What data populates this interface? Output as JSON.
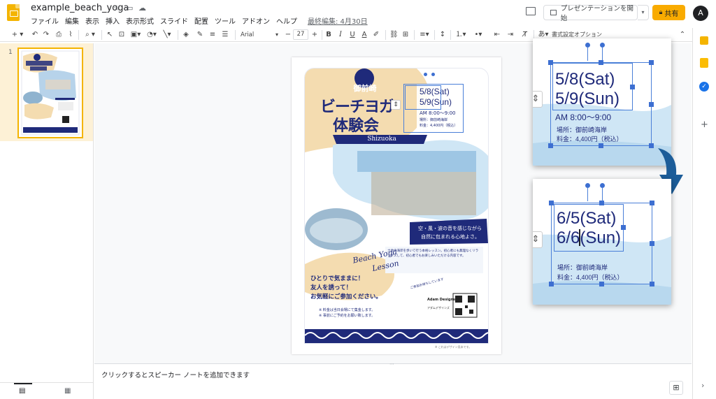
{
  "app": {
    "doc_title": "example_beach_yoga",
    "menu": [
      "ファイル",
      "編集",
      "表示",
      "挿入",
      "表示形式",
      "スライド",
      "配置",
      "ツール",
      "アドオン",
      "ヘルプ"
    ],
    "last_edit": "最終編集: 4月30日",
    "present_label": "プレゼンテーションを開始",
    "share_label": "共有",
    "avatar_letter": "A"
  },
  "toolbar": {
    "font_name": "Arial",
    "font_size": "27",
    "format_options": "書式設定オプション"
  },
  "filmstrip": {
    "slide_number": "1"
  },
  "notes": {
    "placeholder": "クリックするとスピーカー ノートを追加できます"
  },
  "poster": {
    "badge": "御前崎",
    "title_line1": "ビーチヨガ",
    "title_line2": "体験会",
    "ribbon": "Shizuoka",
    "date_line1": "5/8(Sat)",
    "date_line2": "5/9(Sun)",
    "time": "AM 8:00〜9:00",
    "place": "場所：御前崎海岸",
    "fee": "料金：4,400円（税込）",
    "banner_line1": "空・風・波の音を感じながら",
    "banner_line2": "自然に包まれる心地よさ。",
    "description": "土地の海岸を歩いて行う本格レッスン。初心者にも無理なくリラックスして、初心者でもお楽しみいただける内容です。",
    "script_line1": "Beach Yoga",
    "script_line2": "Lesson",
    "invite_line1": "ひとりで気ままに！",
    "invite_line2": "友人を誘って！",
    "invite_line3": "お気軽にご参加ください。",
    "note1": "※ 料金は当日会場にて集金します。",
    "note2": "※ 事前にご予約をお願い致します。",
    "callout_text": "ご参加お待ちしています",
    "brand": "Adam Designs",
    "brand_sub": "アダムデザインズ",
    "footer": "※ これはデザイン見本です。"
  },
  "zoom_before": {
    "line1": "5/8(Sat)",
    "line2": "5/9(Sun)",
    "time": "AM 8:00〜9:00",
    "place": "場所：御前崎海岸",
    "fee": "料金：4,400円（税込）"
  },
  "zoom_after": {
    "line1": "6/5(Sat)",
    "line2": "6/6(Sun)",
    "place": "場所：御前崎海岸",
    "fee": "料金：4,400円（税込）"
  },
  "colors": {
    "navy": "#1f2a7a",
    "sand": "#f4dcb0",
    "sky": "#cfe6f5",
    "selection": "#3d6fd1",
    "share": "#f9ab00",
    "arrow": "#1c5d99"
  }
}
